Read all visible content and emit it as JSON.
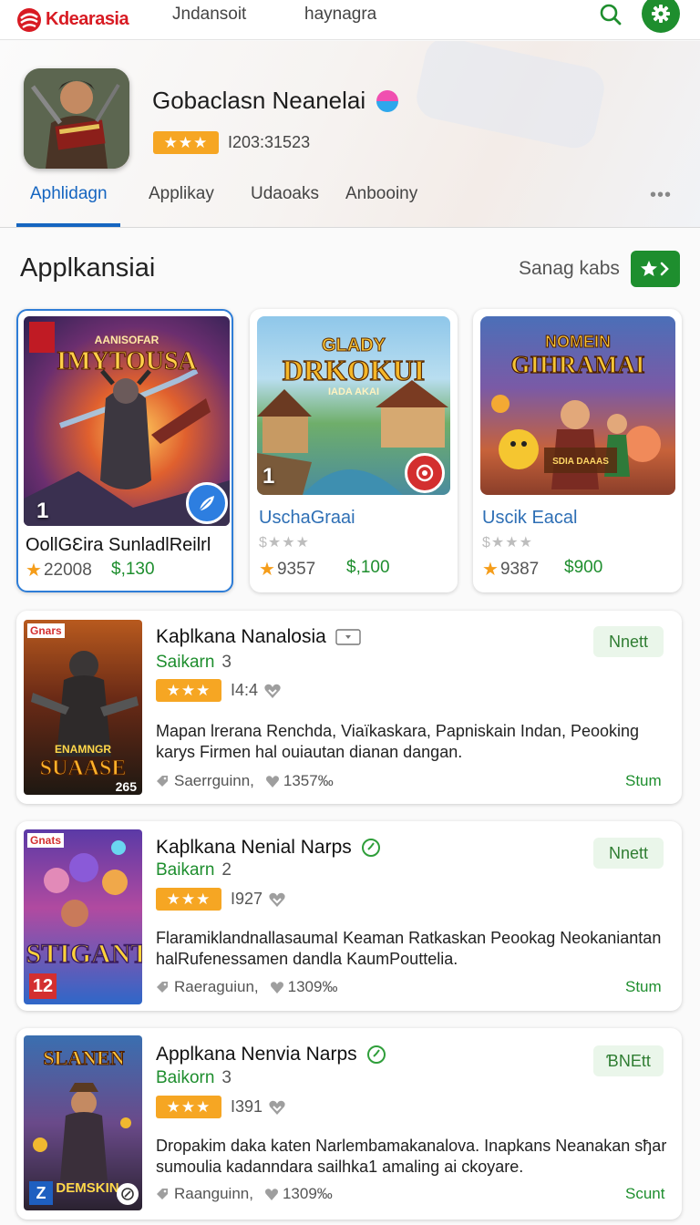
{
  "topbar": {
    "logo_text": "Kdearasia",
    "nav": [
      "Jndansoit",
      "haynagra"
    ]
  },
  "header": {
    "app_title": "Gobaclasn Neanelai",
    "rating_stars": "★★★",
    "count": "I203:31523",
    "tabs": [
      "Aphlidagn",
      "Applikay",
      "Udaoaks",
      "Anbooiny"
    ],
    "more": "•••"
  },
  "section": {
    "title": "Applkansiai",
    "link": "Sanag kabs"
  },
  "featured": [
    {
      "img_title_1": "AANISOFAR",
      "img_title_2": "IMYTOUSA",
      "rank": "1",
      "title": "OollGƐira SunladlReilrl",
      "stars": "",
      "rating": "22008",
      "price": "$,130"
    },
    {
      "img_title_1": "GLADY",
      "img_title_2": "DRKOKUI",
      "img_title_3": "IADA AKAI",
      "rank": "1",
      "title": "UschaGraai",
      "stars": "$★★★",
      "rating": "9357",
      "price": "$,100"
    },
    {
      "img_title_1": "NOMEIN",
      "img_title_2": "GIHRAMAI",
      "img_title_3": "SDIA DAAAS",
      "rank": "",
      "title": "Uscik Eacal",
      "stars": "$★★★",
      "rating": "9387",
      "price": "$900"
    }
  ],
  "list": [
    {
      "tag": "Gnars",
      "img_text_1": "ENAMNGR",
      "img_text_2": "SUAASE",
      "img_badge": "265",
      "title": "Kaþlkana Nanalosia",
      "sub": "Saikarn",
      "sub_num": "3",
      "stars": "★★★",
      "count": "I4:4",
      "desc": "Mapan lrerana Renchda, Viaïkaskara, Papniskain Indan, Peooking karys Firmen hal ouiautan dianan dangan.",
      "foot_tag": "Saerrguinn,",
      "foot_likes": "1357‰",
      "button": "Nnett",
      "status": "Stum"
    },
    {
      "tag": "Gnats",
      "img_text_1": "STIGANT",
      "img_badge": "12",
      "title": "Kaþlkana Nenial Narps",
      "sub": "Baikarn",
      "sub_num": "2",
      "stars": "★★★",
      "count": "I927",
      "desc": "FlaramiklandnallasaumaI Keaman Ratkaskan Peookag Neokaniantan halRufenessamen dandla KaumPouttelia.",
      "foot_tag": "Raeraguiun,",
      "foot_likes": "1309‰",
      "button": "Nnett",
      "status": "Stum"
    },
    {
      "tag": "",
      "img_text_1": "SLANEN",
      "img_text_2": "DEMSKIN",
      "img_badge": "Z",
      "title": "Applkana Nenvia Narps",
      "sub": "Baikorn",
      "sub_num": "3",
      "stars": "★★★",
      "count": "I391",
      "desc": "Dropakim daka katen Narlembamakanalova. Inapkans Neanakan sђar sumoulia kadanndara sailhka1 amaling ai ckoyare.",
      "foot_tag": "Raanguinn,",
      "foot_likes": "1309‰",
      "button": "ƁNEtt",
      "status": "Scunt"
    }
  ],
  "colors": {
    "brand_red": "#d81b23",
    "accent_blue": "#1565c0",
    "accent_green": "#1e8e2e",
    "star_orange": "#f6a623"
  },
  "icons": [
    "search-icon",
    "gear-icon",
    "star-chevron-icon",
    "feather-icon",
    "heart-icon",
    "tag-icon",
    "check-ring-icon"
  ]
}
